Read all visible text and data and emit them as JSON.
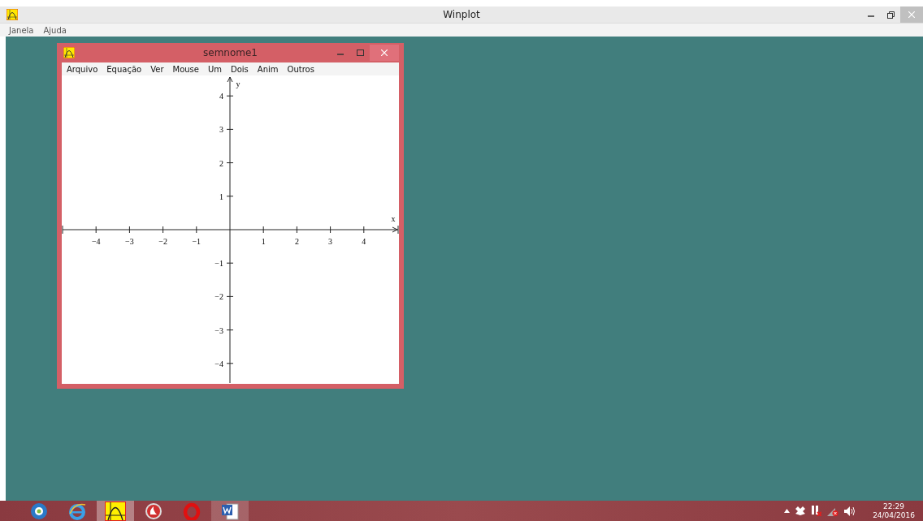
{
  "window": {
    "title": "Winplot"
  },
  "menu": [
    "Janela",
    "Ajuda"
  ],
  "child_window": {
    "title": "semnome1",
    "menu": [
      "Arquivo",
      "Equação",
      "Ver",
      "Mouse",
      "Um",
      "Dois",
      "Anim",
      "Outros"
    ],
    "plot": {
      "x_label": "x",
      "y_label": "y",
      "x_ticks": [
        "−4",
        "−3",
        "−2",
        "−1",
        "1",
        "2",
        "3",
        "4"
      ],
      "y_ticks": [
        "4",
        "3",
        "2",
        "1",
        "−1",
        "−2",
        "−3",
        "−4"
      ]
    }
  },
  "taskbar": {
    "apps": [
      {
        "kind": "gear",
        "selected": false,
        "open": false
      },
      {
        "kind": "browser",
        "selected": false,
        "open": false
      },
      {
        "kind": "winplot",
        "selected": true,
        "open": true
      },
      {
        "kind": "flame",
        "selected": false,
        "open": false
      },
      {
        "kind": "ring",
        "selected": false,
        "open": false
      },
      {
        "kind": "word",
        "selected": false,
        "open": true
      }
    ],
    "time": "22:29",
    "date": "24/04/2016"
  }
}
